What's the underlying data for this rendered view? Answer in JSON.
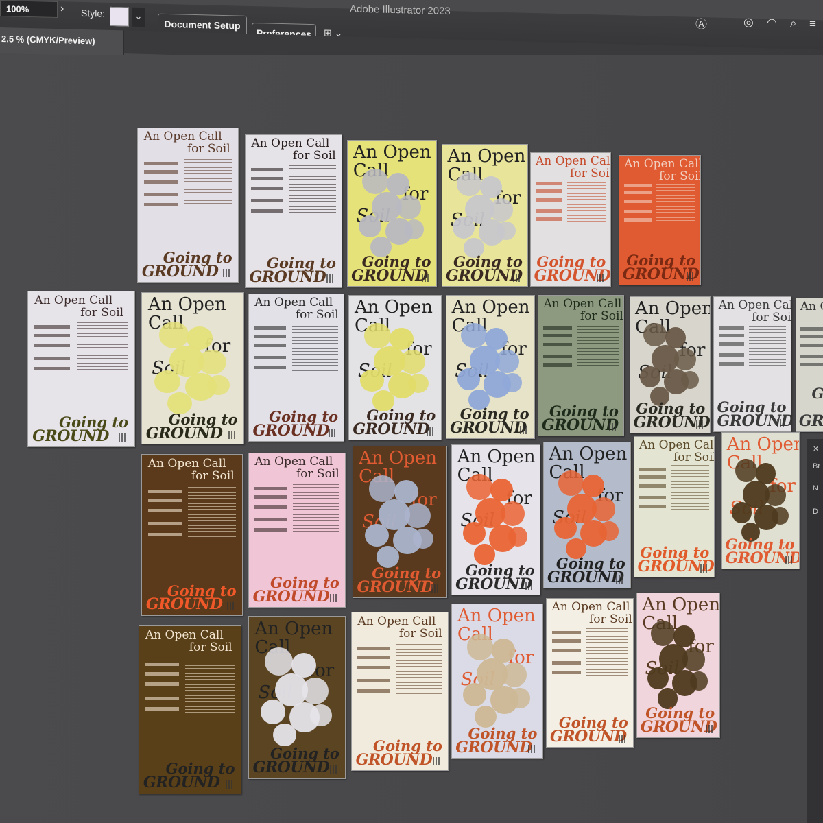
{
  "control_bar": {
    "zoom_value": "100%",
    "style_label": "Style:",
    "document_setup_button": "Document Setup",
    "preferences_button": "Preferences",
    "app_title": "Adobe Illustrator 2023"
  },
  "doc_tab": {
    "label": "2.5 % (CMYK/Preview)"
  },
  "side_panel": {
    "items": [
      "Br",
      "N",
      "D"
    ]
  },
  "poster_text": {
    "headline_a": "An Open Call",
    "headline_b": "for Soil",
    "headline_big_1": "An  Open",
    "headline_big_2": "Call",
    "headline_big_3": "for",
    "headline_big_4": "Soil",
    "footer_1": "Going to",
    "footer_2": "GROUND"
  },
  "posters": [
    {
      "row": 1,
      "variant": "text",
      "bg": "#e2dfe6",
      "ink": "#5a3a2a",
      "accent": "#5a3a22"
    },
    {
      "row": 1,
      "variant": "text",
      "bg": "#e6e3e8",
      "ink": "#2a2020",
      "accent": "#5a3a22"
    },
    {
      "row": 1,
      "variant": "blob",
      "bg": "#e6e27a",
      "ink": "#222",
      "accent": "#3a2a22",
      "blob": "#b8b8c2"
    },
    {
      "row": 1,
      "variant": "blob",
      "bg": "#e8e59a",
      "ink": "#222",
      "accent": "#3a2a22",
      "blob": "#c7c7cc"
    },
    {
      "row": 1,
      "variant": "text",
      "bg": "#e3e0e2",
      "ink": "#c54a2a",
      "accent": "#d4542e"
    },
    {
      "row": 1,
      "variant": "text",
      "bg": "#e05a32",
      "ink": "#f1d0c0",
      "accent": "#7a2a12"
    },
    {
      "row": 2,
      "variant": "text",
      "bg": "#e6e3e9",
      "ink": "#3a2a2a",
      "accent": "#4a4a18"
    },
    {
      "row": 2,
      "variant": "blob",
      "bg": "#e6e3d2",
      "ink": "#222",
      "accent": "#2a2a1a",
      "blob": "#e4e07a"
    },
    {
      "row": 2,
      "variant": "text",
      "bg": "#e3e1e8",
      "ink": "#2a2a2a",
      "accent": "#6a3022"
    },
    {
      "row": 2,
      "variant": "blob",
      "bg": "#e3e3e6",
      "ink": "#222",
      "accent": "#3a2a22",
      "blob": "#e2dc6a"
    },
    {
      "row": 2,
      "variant": "blob",
      "bg": "#e6e3c8",
      "ink": "#222",
      "accent": "#2a2a22",
      "blob": "#8fa8d8"
    },
    {
      "row": 2,
      "variant": "text",
      "bg": "#8d9a80",
      "ink": "#1e2a1a",
      "accent": "#1e2a1a"
    },
    {
      "row": 2,
      "variant": "blob",
      "bg": "#d8d6cc",
      "ink": "#222",
      "accent": "#2a2a22",
      "blob": "#6a5a48"
    },
    {
      "row": 2,
      "variant": "text",
      "bg": "#e4e1e4",
      "ink": "#3a3a3a",
      "accent": "#3a3a3a"
    },
    {
      "row": 2,
      "variant": "text",
      "bg": "#d6d6cc",
      "ink": "#333",
      "accent": "#3a3a3a"
    },
    {
      "row": 3,
      "variant": "text",
      "bg": "#5a3a1a",
      "ink": "#f2e4d0",
      "accent": "#f0582a"
    },
    {
      "row": 3,
      "variant": "text",
      "bg": "#f0c6d6",
      "ink": "#3a2a2a",
      "accent": "#c04a2a"
    },
    {
      "row": 3,
      "variant": "blob",
      "bg": "#5a3a1e",
      "ink": "#e05a32",
      "accent": "#e05a32",
      "blob": "#aab4cc"
    },
    {
      "row": 3,
      "variant": "blob",
      "bg": "#e6e4ea",
      "ink": "#222",
      "accent": "#2a2a2a",
      "blob": "#ea6434"
    },
    {
      "row": 3,
      "variant": "blob",
      "bg": "#b4bccc",
      "ink": "#222",
      "accent": "#222",
      "blob": "#e86434"
    },
    {
      "row": 3,
      "variant": "text",
      "bg": "#e4e4d2",
      "ink": "#5a4a2a",
      "accent": "#e05a2a"
    },
    {
      "row": 3,
      "variant": "blob",
      "bg": "#e0e0d2",
      "ink": "#e05a32",
      "accent": "#e05a32",
      "blob": "#4e3a1e"
    },
    {
      "row": 4,
      "variant": "text",
      "bg": "#5a4018",
      "ink": "#f2e4d0",
      "accent": "#222"
    },
    {
      "row": 4,
      "variant": "blob",
      "bg": "#5a4422",
      "ink": "#222",
      "accent": "#222",
      "blob": "#e6e4ea"
    },
    {
      "row": 4,
      "variant": "text",
      "bg": "#f0ebdc",
      "ink": "#5a3a22",
      "accent": "#c05428"
    },
    {
      "row": 4,
      "variant": "blob",
      "bg": "#dadbe6",
      "ink": "#e05a32",
      "accent": "#c05428",
      "blob": "#cdb894"
    },
    {
      "row": 4,
      "variant": "text",
      "bg": "#f4efe4",
      "ink": "#5a3a22",
      "accent": "#c05428"
    },
    {
      "row": 4,
      "variant": "blob",
      "bg": "#f0d6dc",
      "ink": "#5a3a22",
      "accent": "#c05428",
      "blob": "#4e3a1e"
    }
  ]
}
